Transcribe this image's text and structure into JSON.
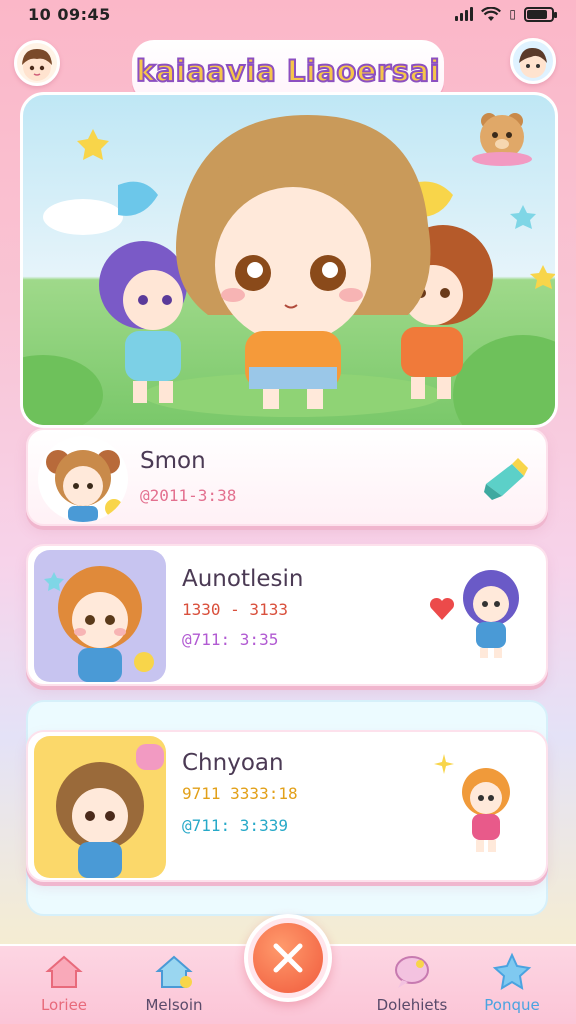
{
  "status_bar": {
    "time": "10 09:45"
  },
  "app": {
    "title": "kaiaavia Liaoersai"
  },
  "hero": {
    "badge_icon": "teddy-bear-icon"
  },
  "characters": [
    {
      "name": "Smon",
      "meta_1": "@2011-3:38",
      "meta_2": "",
      "meta_1_color": "#e3708f",
      "action_icon": "paint-tube-icon"
    },
    {
      "name": "Aunotlesin",
      "meta_1": "1330 - 3133",
      "meta_2": "@711: 3:35",
      "meta_1_color": "#d9503c",
      "meta_2_color": "#b15ad2",
      "action_icon": "heart-icon"
    },
    {
      "name": "Chnyoan",
      "meta_1": "9711 3333:18",
      "meta_2": "@711: 3:339",
      "meta_1_color": "#e2a019",
      "meta_2_color": "#27a9c8",
      "action_icon": "sparkle-icon"
    }
  ],
  "nav": {
    "items": [
      {
        "label": "Loriee",
        "icon": "house-icon",
        "color": "#e86a7b"
      },
      {
        "label": "Melsoin",
        "icon": "home-bell-icon",
        "color": "#5a4a6a"
      },
      {
        "label": "Dolehiets",
        "icon": "chat-bubble-icon",
        "color": "#5a4a6a"
      },
      {
        "label": "Ponque",
        "icon": "star-icon",
        "color": "#4aa3e0"
      }
    ],
    "center_action": "close-icon"
  }
}
